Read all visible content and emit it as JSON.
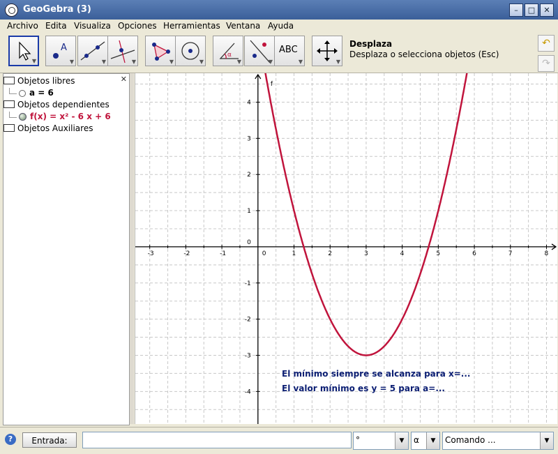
{
  "window": {
    "title": "GeoGebra (3)",
    "buttons": {
      "minimize": "–",
      "maximize": "□",
      "close": "✕"
    }
  },
  "menu": [
    "Archivo",
    "Edita",
    "Visualiza",
    "Opciones",
    "Herramientas",
    "Ventana",
    "Ayuda"
  ],
  "toolbar": {
    "tools": [
      "move",
      "point",
      "line",
      "perpendicular-line",
      "polygon",
      "circle",
      "angle",
      "reflect",
      "text",
      "move-graphics"
    ],
    "text_tool_label": "ABC",
    "description_title": "Desplaza",
    "description_text": "Desplaza o selecciona objetos (Esc)"
  },
  "algebra": {
    "close": "✕",
    "free_objects": "Objetos libres",
    "free_item": "a = 6",
    "dependent_objects": "Objetos dependientes",
    "dependent_item": "f(x) = x² - 6 x + 6",
    "auxiliary_objects": "Objetos Auxiliares"
  },
  "graphics": {
    "function_label": "f",
    "function_color": "#c0143c",
    "text_color": "#0b1e73",
    "text_line1": "El mínimo siempre se alcanza para x=...",
    "text_line2": "El valor mínimo es y = 5 para a=...",
    "x_tick_labels": [
      "-3",
      "-2",
      "-1",
      "0",
      "1",
      "2",
      "3",
      "4",
      "5",
      "6",
      "7",
      "8"
    ],
    "y_tick_labels": [
      "4",
      "3",
      "2",
      "1",
      "0",
      "-1",
      "-2",
      "-3",
      "-4"
    ]
  },
  "chart_data": {
    "type": "line",
    "function": "f(x) = x² - 6 x + 6",
    "xlim": [
      -3.4,
      8.3
    ],
    "ylim": [
      -4.9,
      4.8
    ],
    "grid": true,
    "series": [
      {
        "name": "f",
        "coefficients": [
          1,
          -6,
          6
        ]
      }
    ]
  },
  "input_bar": {
    "help": "?",
    "entry_label": "Entrada:",
    "input_value": "",
    "degree_symbol": "°",
    "alpha_symbol": "α",
    "command_placeholder": "Comando ..."
  }
}
